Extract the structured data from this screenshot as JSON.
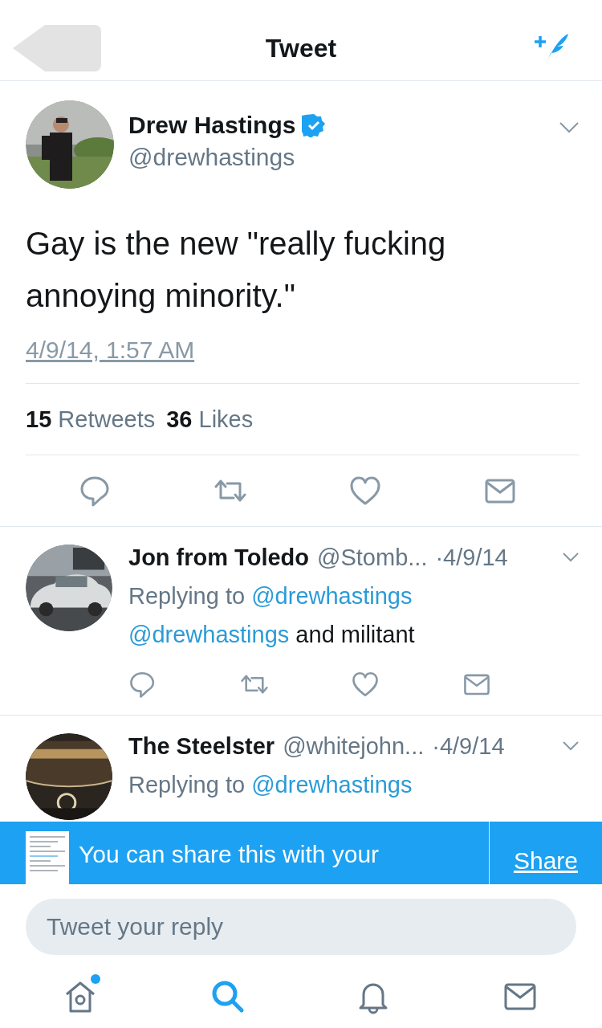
{
  "header": {
    "title": "Tweet"
  },
  "tweet": {
    "name": "Drew Hastings",
    "verified": true,
    "handle": "@drewhastings",
    "text": "Gay is the new \"really fucking annoying minority.\"",
    "date": "4/9/14, 1:57 AM",
    "stats": [
      {
        "count": "15",
        "label": "Retweets"
      },
      {
        "count": "36",
        "label": "Likes"
      }
    ]
  },
  "replies": [
    {
      "name": "Jon from Toledo",
      "handle": "@Stomb...",
      "date": "·4/9/14",
      "replying_label": "Replying to",
      "replying_to": "@drewhastings",
      "mention": "@drewhastings",
      "text": "and militant"
    },
    {
      "name": "The Steelster",
      "handle": "@whitejohn...",
      "date": "·4/9/14",
      "replying_label": "Replying to",
      "replying_to": "@drewhastings"
    }
  ],
  "banner": {
    "text": "You can share this with your",
    "action": "Share"
  },
  "reply_field": {
    "placeholder": "Tweet your reply"
  },
  "tabs": [
    {
      "kind": "home",
      "selected": false,
      "unread": true
    },
    {
      "kind": "search",
      "selected": true,
      "unread": false
    },
    {
      "kind": "notifications",
      "selected": false,
      "unread": false
    },
    {
      "kind": "messages",
      "selected": false,
      "unread": false
    }
  ]
}
